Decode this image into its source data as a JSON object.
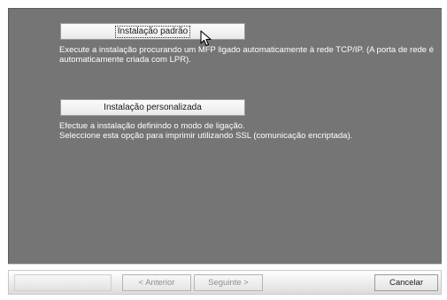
{
  "options": {
    "standard": {
      "button_label": "Instalação padrão",
      "description": "Execute a instalação procurando um MFP ligado automaticamente à rede TCP/IP. (A porta de rede é automaticamente criada com LPR)."
    },
    "custom": {
      "button_label": "Instalação personalizada",
      "description_line1": "Efectue a instalação definindo o modo de ligação.",
      "description_line2": "Seleccione esta opção para imprimir utilizando SSL (comunicação encriptada)."
    }
  },
  "footer": {
    "back_label": "< Anterior",
    "next_label": "Seguinte >",
    "cancel_label": "Cancelar"
  },
  "cursor": {
    "icon": "mouse-pointer-icon"
  }
}
